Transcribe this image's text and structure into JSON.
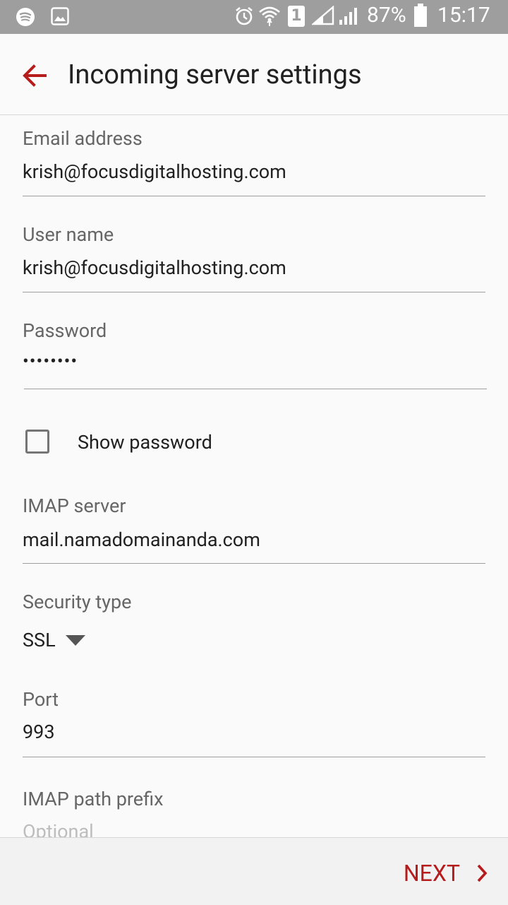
{
  "status_bar": {
    "icons": [
      "spotify-icon",
      "image-notification-icon",
      "alarm-icon",
      "wifi-icon",
      "sim-1-icon",
      "signal-icon",
      "signal-icon",
      "battery-icon"
    ],
    "battery": "87%",
    "time": "15:17",
    "sim_slot": "1"
  },
  "app_bar": {
    "title": "Incoming server settings",
    "accent_color": "#b71c1c"
  },
  "form": {
    "email": {
      "label": "Email address",
      "value": "krish@focusdigitalhosting.com"
    },
    "username": {
      "label": "User name",
      "value": "krish@focusdigitalhosting.com"
    },
    "password": {
      "label": "Password",
      "value": "••••••••"
    },
    "show_password": {
      "label": "Show password",
      "checked": false
    },
    "imap_server": {
      "label": "IMAP server",
      "value": "mail.namadomainanda.com"
    },
    "security_type": {
      "label": "Security type",
      "value": "SSL"
    },
    "port": {
      "label": "Port",
      "value": "993"
    },
    "imap_path_prefix": {
      "label": "IMAP path prefix",
      "placeholder": "Optional"
    }
  },
  "bottom_bar": {
    "next_label": "NEXT"
  }
}
